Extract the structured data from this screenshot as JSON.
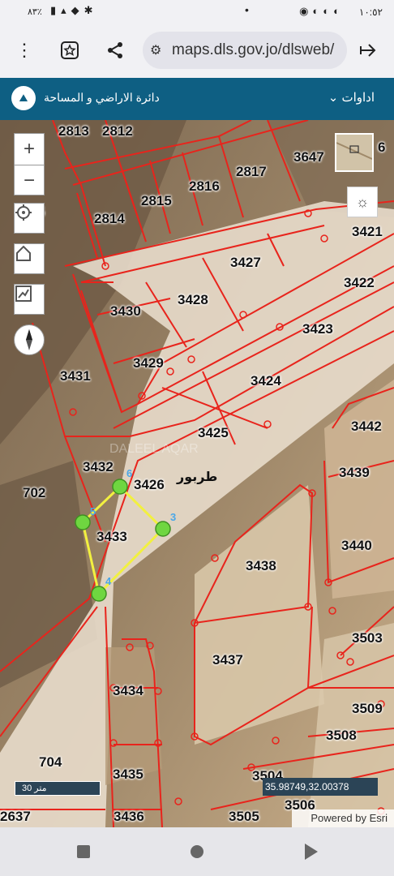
{
  "status_bar": {
    "time": "١٠:٥٢",
    "battery": "٨٣٪",
    "left_icons": [
      "battery-icon",
      "signal-icon",
      "wifi-icon",
      "bluetooth-icon"
    ],
    "right_icons": [
      "notification-dot",
      "whatsapp-icon",
      "app-icon",
      "app-icon",
      "app-icon",
      "app-icon"
    ]
  },
  "browser": {
    "url": "maps.dls.gov.jo/dlsweb/"
  },
  "app_header": {
    "department": "دائرة الاراضي و المساحة",
    "tools_menu": "اداوات"
  },
  "map": {
    "parcels": [
      "2813",
      "2812",
      "3647",
      "2817",
      "2816",
      "2815",
      "2814",
      "55",
      "3421",
      "3427",
      "3422",
      "3428",
      "3430",
      "3423",
      "3429",
      "3424",
      "3431",
      "3442",
      "3425",
      "3432",
      "3426",
      "3439",
      "702",
      "3433",
      "3440",
      "3438",
      "3503",
      "3437",
      "3434",
      "3509",
      "3508",
      "704",
      "3435",
      "3504",
      "3506",
      "3436",
      "3505",
      "2637",
      "6"
    ],
    "place_name": "طربور",
    "watermark": "DALEEL AQAR",
    "vertex_labels": [
      "6",
      "5",
      "3",
      "4"
    ],
    "scale_label": "30 متر",
    "coordinates": "35.98749,32.00378",
    "attribution": "Powered by Esri",
    "colors": {
      "parcel_lines": "#e8241c",
      "selection": "#f2f040",
      "vertex": "#6fd640",
      "vertex_label": "#4aa7e8",
      "panel": "#2b4456"
    }
  }
}
